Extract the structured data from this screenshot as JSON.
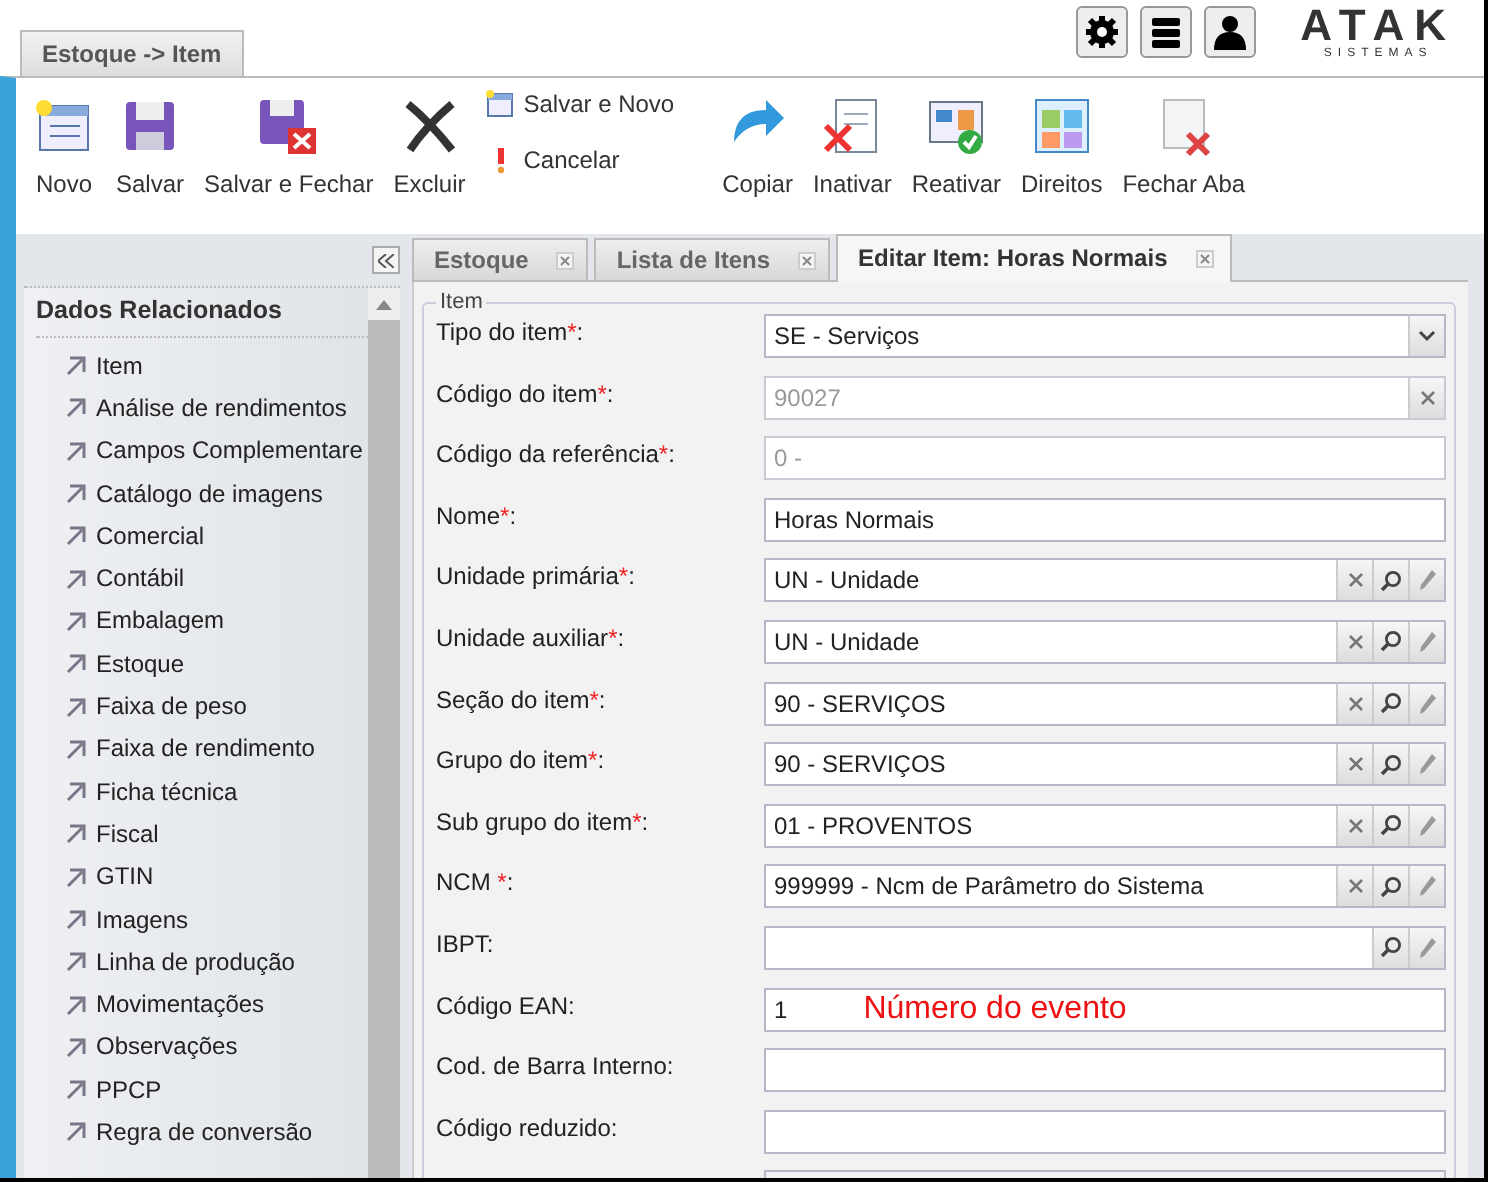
{
  "header": {
    "module_tab": "Estoque -> Item",
    "logo": "ATAK",
    "logo_sub": "SISTEMAS"
  },
  "toolbar": [
    {
      "kind": "big",
      "label": "Novo"
    },
    {
      "kind": "big",
      "label": "Salvar"
    },
    {
      "kind": "big",
      "label": "Salvar e Fechar"
    },
    {
      "kind": "big",
      "label": "Excluir"
    },
    {
      "kind": "small",
      "label": "Salvar e Novo"
    },
    {
      "kind": "small",
      "label": "Cancelar"
    },
    {
      "kind": "big",
      "label": "Copiar"
    },
    {
      "kind": "big",
      "label": "Inativar"
    },
    {
      "kind": "big",
      "label": "Reativar"
    },
    {
      "kind": "big",
      "label": "Direitos"
    },
    {
      "kind": "big",
      "label": "Fechar Aba"
    }
  ],
  "sidebar": {
    "title": "Dados Relacionados",
    "items": [
      "Item",
      "Análise de rendimentos",
      "Campos Complementare",
      "Catálogo de imagens",
      "Comercial",
      "Contábil",
      "Embalagem",
      "Estoque",
      "Faixa de peso",
      "Faixa de rendimento",
      "Ficha técnica",
      "Fiscal",
      "GTIN",
      "Imagens",
      "Linha de produção",
      "Movimentações",
      "Observações",
      "PPCP",
      "Regra de conversão"
    ]
  },
  "tabs": [
    {
      "label": "Estoque",
      "selected": false
    },
    {
      "label": "Lista de Itens",
      "selected": false
    },
    {
      "label": "Editar Item: Horas Normais",
      "selected": true
    }
  ],
  "form": {
    "legend": "Item",
    "fields": [
      {
        "label": "Tipo do item",
        "required_mark": "*",
        "colon": ":",
        "kind": "select",
        "value": "SE - Serviços",
        "disabled": false
      },
      {
        "label": "Código do item",
        "required_mark": "*",
        "colon": ":",
        "kind": "clearable",
        "value": "90027",
        "disabled": true
      },
      {
        "label": "Código da referência",
        "required_mark": "*",
        "colon": ":",
        "kind": "text",
        "value": "0 -",
        "disabled": true
      },
      {
        "label": "Nome",
        "required_mark": "*",
        "colon": ":",
        "kind": "text",
        "value": "Horas Normais",
        "disabled": false
      },
      {
        "label": "Unidade primária",
        "required_mark": "*",
        "colon": ":",
        "kind": "lookup",
        "value": "UN - Unidade",
        "disabled": false
      },
      {
        "label": "Unidade auxiliar",
        "required_mark": "*",
        "colon": ":",
        "kind": "lookup",
        "value": "UN - Unidade",
        "disabled": false
      },
      {
        "label": "Seção do item",
        "required_mark": "*",
        "colon": ":",
        "kind": "lookup",
        "value": "90 - SERVIÇOS",
        "disabled": false
      },
      {
        "label": "Grupo do item",
        "required_mark": "*",
        "colon": ":",
        "kind": "lookup",
        "value": "90 - SERVIÇOS",
        "disabled": false
      },
      {
        "label": "Sub grupo do item",
        "required_mark": "*",
        "colon": ":",
        "kind": "lookup",
        "value": "01 - PROVENTOS",
        "disabled": false
      },
      {
        "label": "NCM ",
        "required_mark": "*",
        "colon": ":",
        "kind": "lookup",
        "value": "999999 - Ncm de Parâmetro do Sistema",
        "disabled": false
      },
      {
        "label": "IBPT:",
        "kind": "search",
        "disabled": false
      },
      {
        "label": "Código EAN:",
        "kind": "text",
        "value": "1",
        "disabled": false,
        "annotation": "Número do evento"
      },
      {
        "label": "Cod. de Barra Interno:",
        "kind": "text",
        "disabled": false
      },
      {
        "label": "Código reduzido:",
        "kind": "text",
        "disabled": false
      }
    ]
  }
}
